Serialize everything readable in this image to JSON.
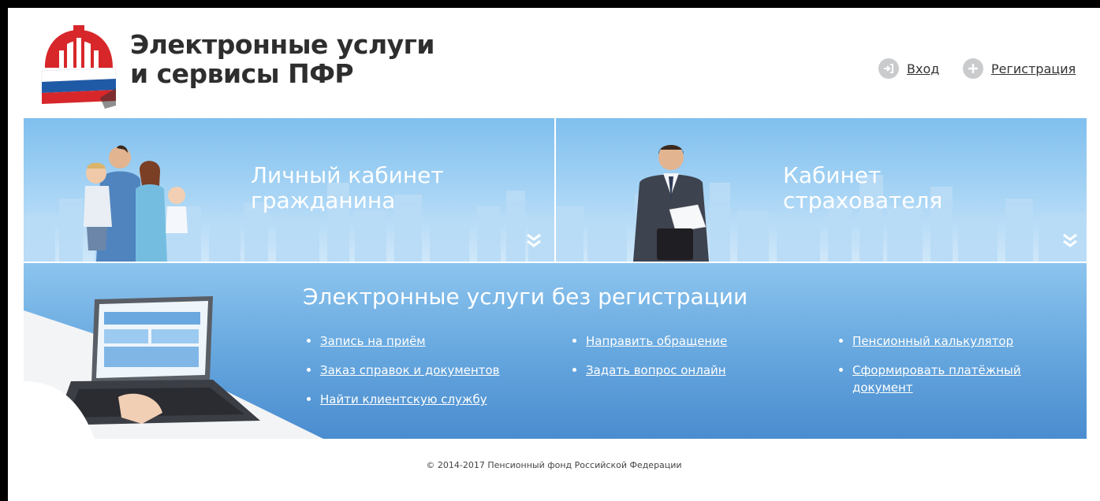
{
  "header": {
    "title_line1": "Электронные услуги",
    "title_line2": "и сервисы ПФР",
    "login_label": "Вход",
    "register_label": "Регистрация"
  },
  "banners": {
    "citizen": {
      "line1": "Личный кабинет",
      "line2": "гражданина"
    },
    "insurer": {
      "line1": "Кабинет",
      "line2": "страхователя"
    }
  },
  "services": {
    "title": "Электронные услуги без регистрации",
    "col1": [
      "Запись на приём",
      "Заказ справок и документов",
      "Найти клиентскую службу"
    ],
    "col2": [
      "Направить обращение",
      "Задать вопрос онлайн"
    ],
    "col3": [
      "Пенсионный калькулятор",
      "Сформировать платёжный документ"
    ]
  },
  "footer": {
    "copyright": "© 2014-2017 Пенсионный фонд Российской Федерации"
  },
  "colors": {
    "logo_red": "#d7272a",
    "logo_blue": "#1f5aa6",
    "banner_sky": "#9fd0f3",
    "services_blue": "#4a8ccf",
    "auth_icon": "#c9cbcd"
  }
}
